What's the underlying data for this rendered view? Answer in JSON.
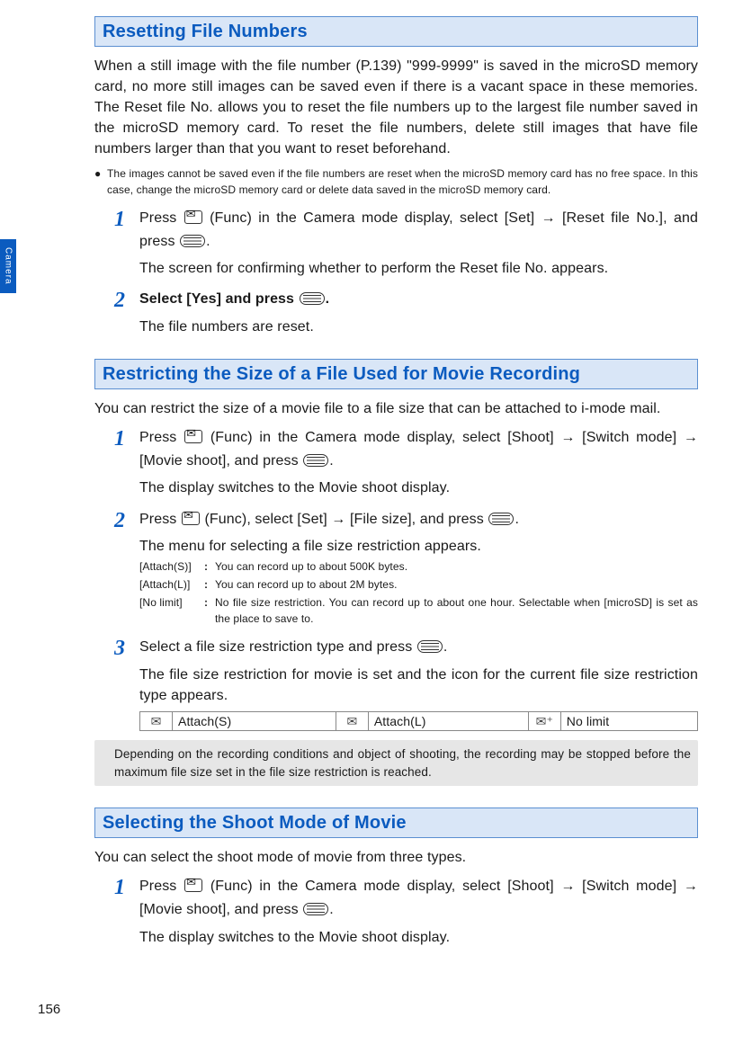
{
  "sideTab": "Camera",
  "pageNumber": "156",
  "sections": [
    {
      "title": "Resetting File Numbers",
      "intro": "When a still image with the file number (P.139) \"999-9999\" is saved in the microSD memory card, no more still images can be saved even if there is a vacant space in these memories. The Reset file No. allows you to reset the file numbers up to the largest file number saved in the microSD memory card. To reset the file numbers, delete still images that have file numbers larger than that you want to reset beforehand.",
      "bullets": [
        "The images cannot be saved even if the file numbers are reset when the microSD memory card has no free space. In this case, change the microSD memory card or delete data saved in the microSD memory card."
      ],
      "steps": [
        {
          "num": "1",
          "parts": [
            "Press ",
            " (Func) in the Camera mode display, select [Set] → [Reset file No.], and press ",
            "."
          ],
          "note": "The screen for confirming whether to perform the Reset file No. appears."
        },
        {
          "num": "2",
          "parts": [
            "Select [Yes] and press ",
            "."
          ],
          "note": "The file numbers are reset."
        }
      ]
    },
    {
      "title": "Restricting the Size of a File Used for Movie Recording",
      "intro": "You can restrict the size of a movie file to a file size that can be attached to i-mode mail.",
      "steps": [
        {
          "num": "1",
          "parts": [
            "Press ",
            " (Func) in the Camera mode display, select [Shoot] → [Switch mode] → [Movie shoot], and press ",
            "."
          ],
          "note": "The display switches to the Movie shoot display."
        },
        {
          "num": "2",
          "parts": [
            "Press ",
            " (Func), select [Set] → [File size], and press ",
            "."
          ],
          "note": "The menu for selecting a file size restriction appears.",
          "options": [
            {
              "label": "[Attach(S)]",
              "desc": "You can record up to about 500K bytes."
            },
            {
              "label": "[Attach(L)]",
              "desc": "You can record up to about 2M bytes."
            },
            {
              "label": "[No limit]",
              "desc": "No file size restriction. You can record up to about one hour. Selectable when [microSD] is set as the place to save to."
            }
          ]
        },
        {
          "num": "3",
          "parts": [
            "Select a file size restriction type and press ",
            "."
          ],
          "note": "The file size restriction for movie is set and the icon for the current file size restriction type appears.",
          "iconTable": [
            {
              "label": "Attach(S)"
            },
            {
              "label": "Attach(L)"
            },
            {
              "label": "No limit"
            }
          ]
        }
      ],
      "noteBox": "Depending on the recording conditions and object of shooting, the recording may be stopped before the maximum file size set in the file size restriction is reached."
    },
    {
      "title": "Selecting the Shoot Mode of Movie",
      "intro": "You can select the shoot mode of movie from three types.",
      "steps": [
        {
          "num": "1",
          "parts": [
            "Press ",
            " (Func) in the Camera mode display, select [Shoot] → [Switch mode] → [Movie shoot], and press ",
            "."
          ],
          "note": "The display switches to the Movie shoot display."
        }
      ]
    }
  ]
}
